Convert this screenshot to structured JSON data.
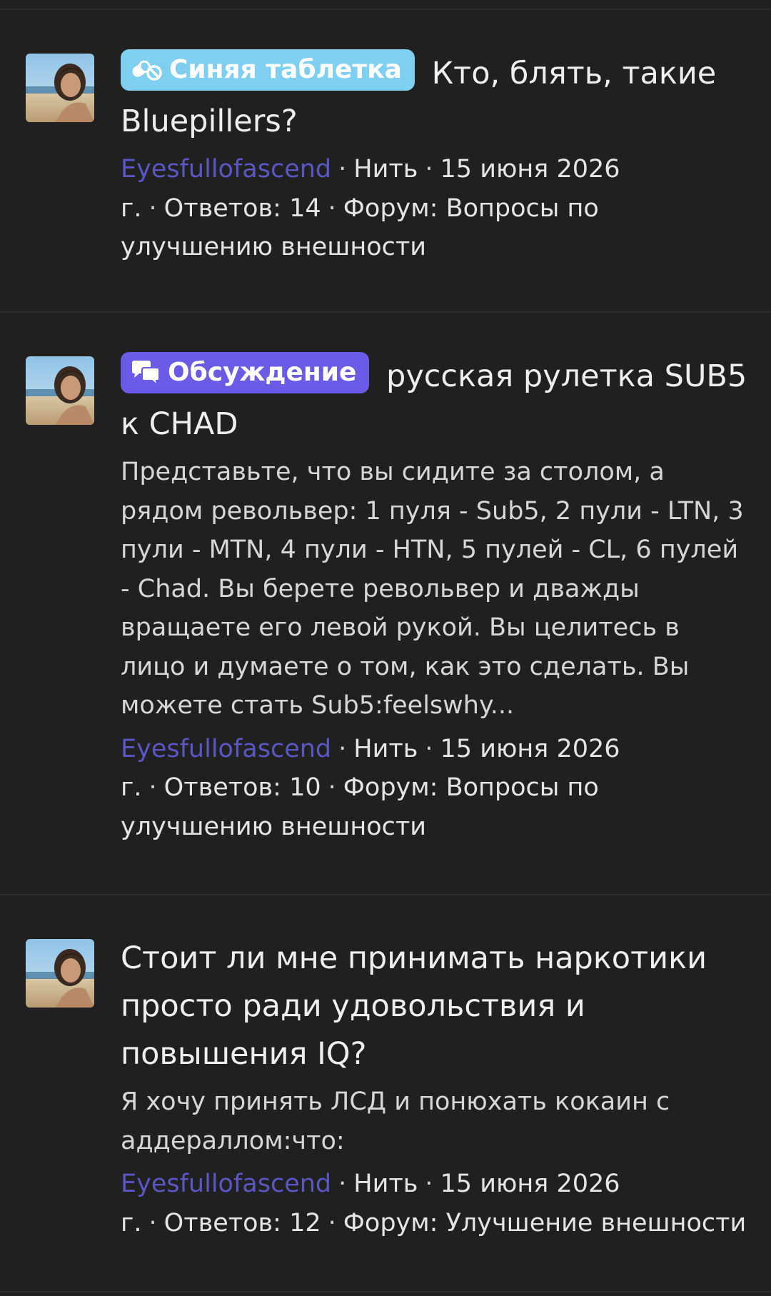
{
  "threads": [
    {
      "prefix": "Синяя таблетка",
      "prefix_color": "#7fd0f0",
      "prefix_icon": "pills-icon",
      "title": "Кто, блять, такие Bluepillers?",
      "snippet": "",
      "author": "Eyesfullofascend",
      "type": "Нить",
      "date": "15 июня 2026 г.",
      "replies": "Ответов: 14",
      "forum": "Форум: Вопросы по улучшению внешности"
    },
    {
      "prefix": "Обсуждение",
      "prefix_color": "#6b5ae6",
      "prefix_icon": "chat-bubbles-icon",
      "title": "русская рулетка SUB5 к CHAD",
      "snippet": "Представьте, что вы сидите за столом, а рядом револьвер: 1 пуля - Sub5, 2 пули - LTN, 3 пули - MTN, 4 пули - HTN, 5 пулей - CL, 6 пулей - Chad. Вы берете револьвер и дважды вращаете его левой рукой. Вы целитесь в лицо и думаете о том, как это сделать. Вы можете стать Sub5:feelswhy...",
      "author": "Eyesfullofascend",
      "type": "Нить",
      "date": "15 июня 2026 г.",
      "replies": "Ответов: 10",
      "forum": "Форум: Вопросы по улучшению внешности"
    },
    {
      "prefix": "",
      "title": "Стоит ли мне принимать наркотики просто ради удовольствия и повышения IQ?",
      "snippet": "Я хочу принять ЛСД и понюхать кокаин с аддераллом:что:",
      "author": "Eyesfullofascend",
      "type": "Нить",
      "date": "15 июня 2026 г.",
      "replies": "Ответов: 12",
      "forum": "Форум: Улучшение внешности"
    }
  ],
  "colors": {
    "background": "#202020",
    "author_link": "#5a57c4",
    "text": "#eeeeee"
  }
}
